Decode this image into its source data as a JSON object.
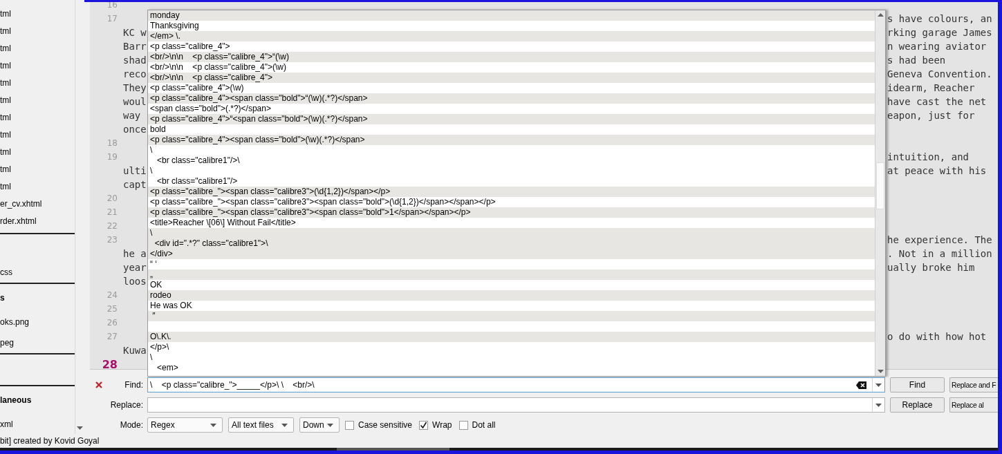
{
  "sidebar": {
    "groups": [
      {
        "kind": "list",
        "files": [
          "tml",
          "tml",
          "tml",
          "tml",
          "tml",
          "tml",
          "tml",
          "tml",
          "tml",
          "tml",
          "tml",
          "er_cv.xhtml",
          "rder.xhtml"
        ]
      },
      {
        "kind": "list",
        "files": [
          "css"
        ]
      },
      {
        "kind": "list",
        "header": "s",
        "files": [
          "oks.png",
          "peg"
        ]
      },
      {
        "kind": "empty"
      },
      {
        "kind": "list",
        "header": "laneous",
        "files": [
          "xml"
        ]
      }
    ]
  },
  "editor": {
    "rows": [
      {
        "number": "16",
        "current": false
      },
      {
        "number": "17",
        "current": false,
        "right": "s have colours, an"
      },
      {
        "left": "KC w",
        "right": "rking garage James"
      },
      {
        "left": "Barr",
        "right": "n wearing aviator"
      },
      {
        "left": "shad",
        "right": "s had been"
      },
      {
        "left": "reco",
        "right": "Geneva Convention."
      },
      {
        "left": "They",
        "right": "idearm, Reacher"
      },
      {
        "left": "woul",
        "right": "have cast the net"
      },
      {
        "left": "way",
        "right": "eapon, just for"
      },
      {
        "left": "once"
      },
      {
        "number": "18",
        "current": false
      },
      {
        "number": "19",
        "current": false,
        "right": "intuition, and"
      },
      {
        "left": "ulti",
        "right": "at peace with his"
      },
      {
        "left": "capt"
      },
      {
        "number": "20",
        "current": false
      },
      {
        "number": "21",
        "current": false
      },
      {
        "number": "22",
        "current": false
      },
      {
        "number": "23",
        "current": false,
        "right": "he experience. The"
      },
      {
        "left": "he a",
        "right": ". Not in a million"
      },
      {
        "left": "year",
        "right": "ually broke him"
      },
      {
        "left": "loos"
      },
      {
        "number": "24",
        "current": false
      },
      {
        "number": "25",
        "current": false
      },
      {
        "number": "26",
        "current": false
      },
      {
        "number": "27",
        "current": false,
        "right": "o do with how hot"
      },
      {
        "left": "Kuwa"
      },
      {
        "number": "28",
        "current": true
      }
    ]
  },
  "completion_popup": {
    "entries": [
      [
        "monday"
      ],
      [
        "Thanksgiving"
      ],
      [
        "</em> \\."
      ],
      [
        "<p class=\"calibre_4\">"
      ],
      [
        "<br/>\\n\\n    <p class=\"calibre_4\">“(\\w)"
      ],
      [
        "<br/>\\n\\n    <p class=\"calibre_4\">(\\w)"
      ],
      [
        "<br/>\\n\\n    <p class=\"calibre_4\">"
      ],
      [
        "<p class=\"calibre_4\">(\\w)"
      ],
      [
        "<p class=\"calibre_4\"><span class=\"bold\">“(\\w)(.*?)</span>"
      ],
      [
        "<span class=\"bold\">(.*?)</span>"
      ],
      [
        "<p class=\"calibre_4\">“<span class=\"bold\">(\\w)(.*?)</span>"
      ],
      [
        "bold"
      ],
      [
        "<p class=\"calibre_4\"><span class=\"bold\">(\\w)(.*?)</span>"
      ],
      [
        "\\",
        "   <br class=\"calibre1\"/>\\",
        "\\",
        "   <br class=\"calibre1\"/>"
      ],
      [
        "<p class=\"calibre_\"><span class=\"calibre3\">(\\d{1,2})</span></p>"
      ],
      [
        "<p class=\"calibre_\"><span class=\"calibre3\"><span class=\"bold\">(\\d{1,2})</span></span></p>"
      ],
      [
        "<p class=\"calibre_\"><span class=\"calibre3\"><span class=\"bold\">1</span></span></p>"
      ],
      [
        "<title>Reacher \\[06\\] Without Fail</title>"
      ],
      [
        "\\",
        "  <div id=\".*?\" class=\"calibre1\">\\",
        "</div>"
      ],
      [
        "“ ‘"
      ],
      [
        "„"
      ],
      [
        "OK"
      ],
      [
        "rodeo"
      ],
      [
        "He was OK"
      ],
      [
        " ″"
      ],
      {
        "kind": "blank"
      },
      [
        "O\\.K\\."
      ],
      [
        "</p>\\",
        "\\",
        "   <em>"
      ]
    ]
  },
  "find_panel": {
    "find": {
      "label": "Find:",
      "value": "\\    <p class=\"calibre_\">_____</p>\\ \\    <br/>\\"
    },
    "replace": {
      "label": "Replace:"
    },
    "mode": {
      "label": "Mode:",
      "dropdowns": [
        "Regex",
        "All text files",
        "Down"
      ],
      "options": [
        {
          "label": "Case sensitive",
          "checked": false
        },
        {
          "label": "Wrap",
          "checked": true
        },
        {
          "label": "Dot all",
          "checked": false
        }
      ]
    },
    "find_buttons": [
      "Find",
      "Replace and F"
    ],
    "replace_buttons": [
      "Replace",
      "Replace al"
    ]
  },
  "status_bar": {
    "text": "bit] created by Kovid Goyal"
  }
}
